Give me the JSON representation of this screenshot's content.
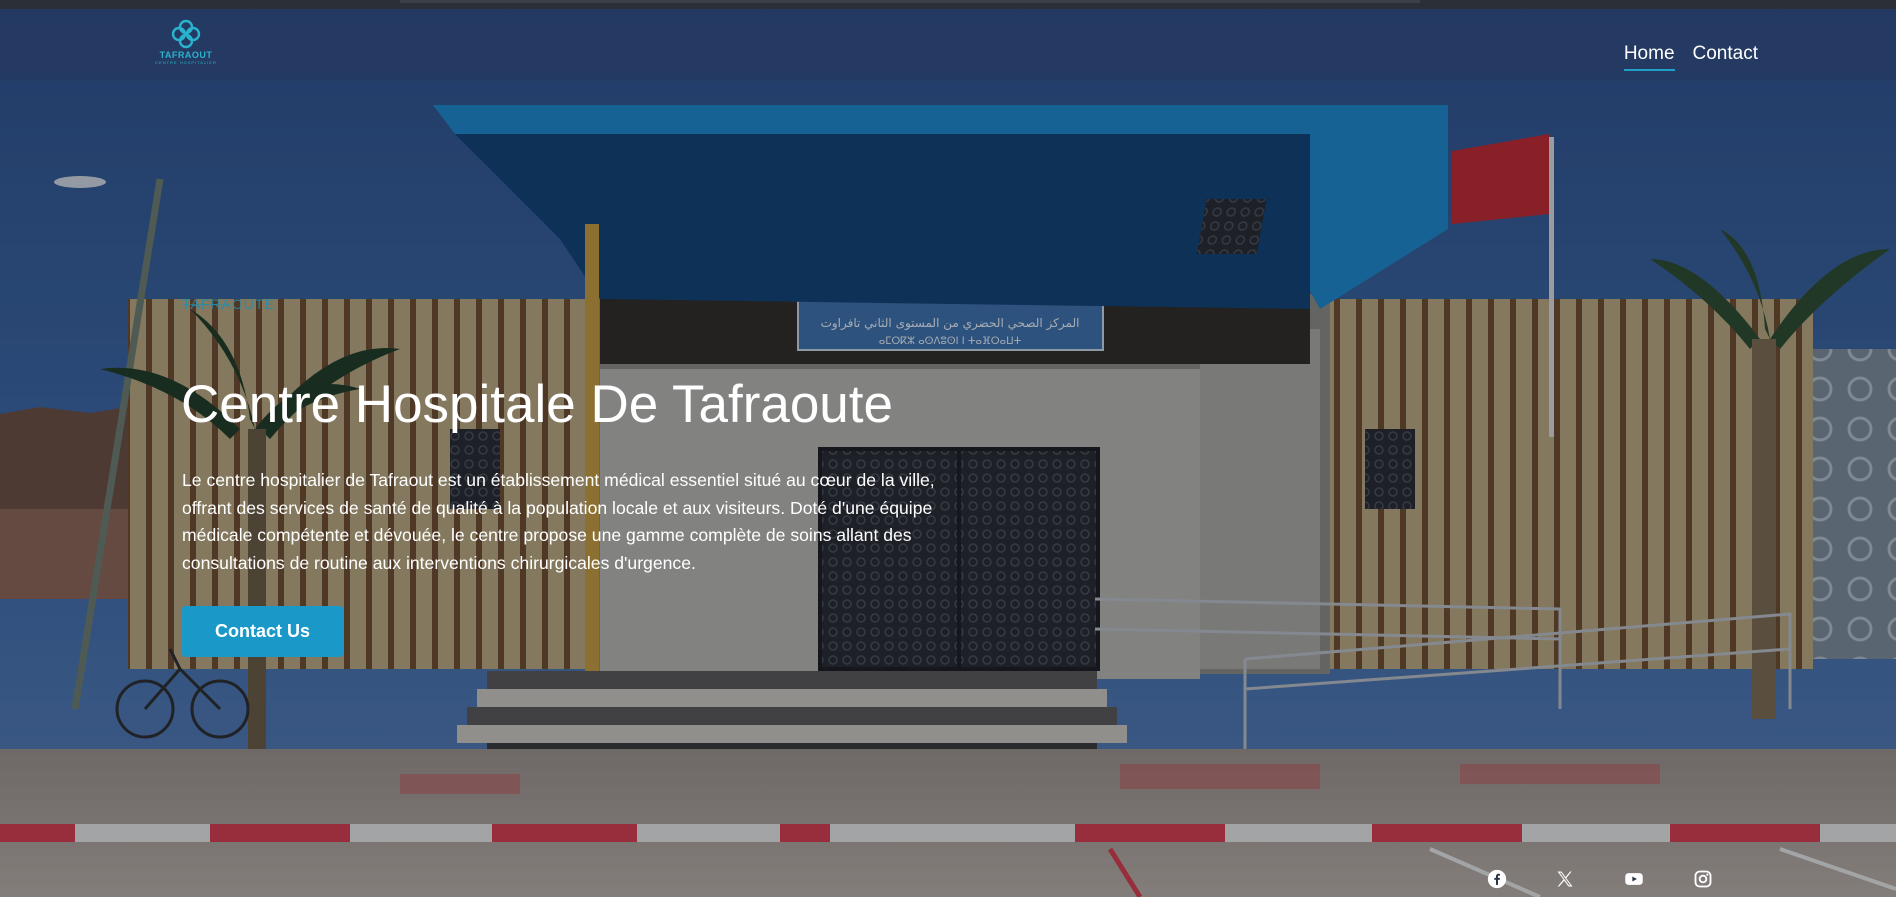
{
  "brand": {
    "logo_text": "TAFRAOUT",
    "logo_subtext": "CENTRE HOSPITALIER"
  },
  "nav": {
    "items": [
      {
        "label": "Home",
        "active": true
      },
      {
        "label": "Contact",
        "active": false
      }
    ]
  },
  "hero": {
    "kicker": "TAFRAOUTE",
    "title": "Centre Hospitale De Tafraoute",
    "description": "Le centre hospitalier de Tafraout est un établissement médical essentiel situé au cœur de la ville, offrant des services de santé de qualité à la population locale et aux visiteurs. Doté d'une équipe médicale compétente et dévouée, le centre propose une gamme complète de soins allant des consultations de routine aux interventions chirurgicales d'urgence.",
    "cta_label": "Contact Us",
    "building_sign": "المركز الصحي الحضري من المستوى الثاني تافراوت"
  },
  "social": [
    {
      "icon": "facebook-icon"
    },
    {
      "icon": "x-icon"
    },
    {
      "icon": "youtube-icon"
    },
    {
      "icon": "instagram-icon"
    }
  ],
  "colors": {
    "accent": "#1a99c9",
    "logo": "#2ab3cf",
    "nav_underline": "#1ea0c9",
    "canopy": "#1e86c8",
    "flag": "#c1272d"
  }
}
